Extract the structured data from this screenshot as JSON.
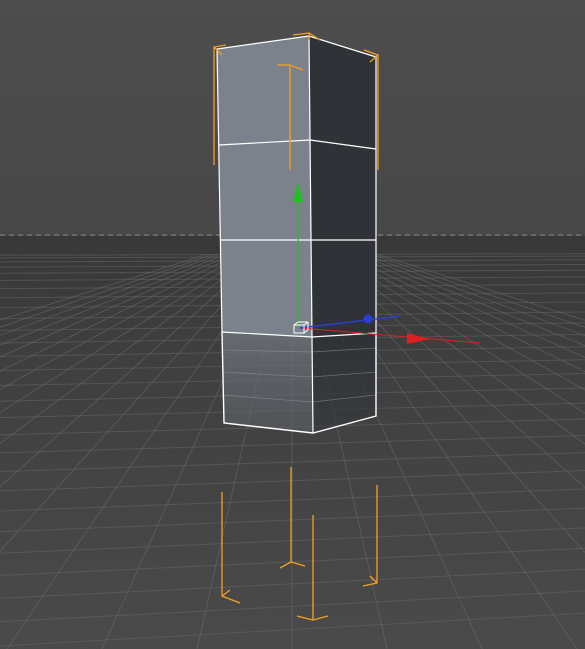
{
  "viewport": {
    "background_color": "#4a4a4a",
    "floor_color": "#3e3e3e",
    "grid_line_color": "#6a6a6a",
    "horizon_line_color": "#808080",
    "horizon_style": "dashed"
  },
  "object": {
    "type": "box",
    "segments": 3,
    "selected": true,
    "front_face_color": "#7b828b",
    "side_face_color": "#2f3337",
    "edge_color": "#ffffff",
    "reflection_visible": true
  },
  "bounding_box": {
    "color": "#f5a01e",
    "visible": true
  },
  "axis_gizmo": {
    "x_axis_color": "#e02020",
    "y_axis_color": "#20c020",
    "z_axis_color": "#2a3dd8",
    "origin_icon": "cube-origin-icon"
  }
}
